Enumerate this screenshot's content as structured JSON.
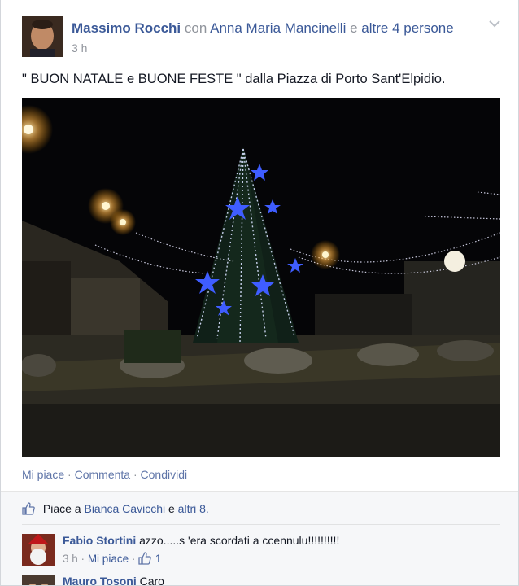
{
  "post": {
    "author": "Massimo Rocchi",
    "with_word": "con",
    "tagged": "Anna Maria Mancinelli",
    "and_word": "e",
    "others": "altre 4 persone",
    "time": "3 h",
    "text": "\" BUON NATALE e BUONE FESTE \" dalla Piazza di Porto Sant'Elpidio."
  },
  "actions": {
    "like": "Mi piace",
    "comment": "Commenta",
    "share": "Condividi",
    "separator": "·"
  },
  "likes": {
    "prefix": "Piace a",
    "name": "Bianca Cavicchi",
    "and_word": "e",
    "others": "altri 8."
  },
  "comments": [
    {
      "author": "Fabio Stortini",
      "text": "azzo.....s 'era scordati a ccennulu!!!!!!!!!!",
      "time": "3 h",
      "like": "Mi piace",
      "like_count": "1"
    },
    {
      "author": "Mauro Tosoni",
      "text": "Caro"
    }
  ],
  "icons": {
    "menu": "chevron-down-icon",
    "like": "thumbs-up-icon"
  },
  "colors": {
    "link": "#3b5998",
    "meta": "#90949c",
    "text": "#141823"
  }
}
